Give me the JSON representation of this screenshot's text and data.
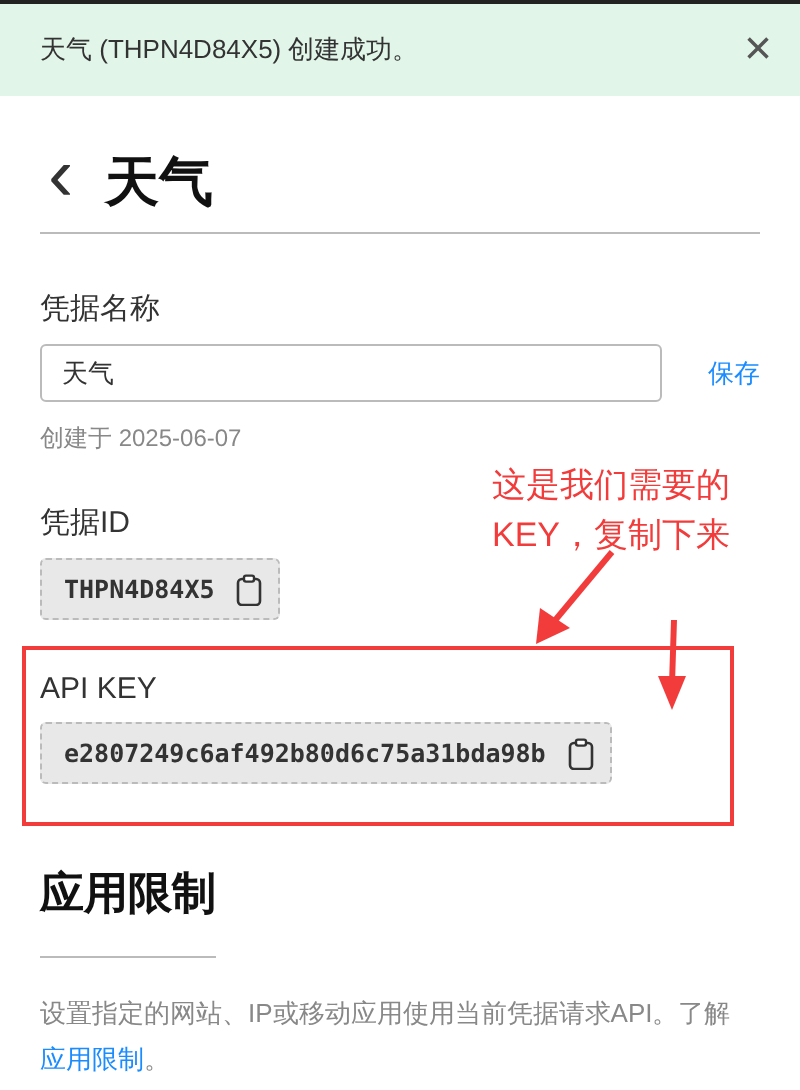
{
  "toast": {
    "message": "天气 (THPN4D84X5) 创建成功。",
    "close": "×"
  },
  "header": {
    "back": "‹",
    "title": "天气"
  },
  "name_field": {
    "label": "凭据名称",
    "value": "天气",
    "save": "保存",
    "created": "创建于 2025-06-07"
  },
  "credential_id": {
    "label": "凭据ID",
    "value": "THPN4D84X5"
  },
  "api_key": {
    "label": "API KEY",
    "value": "e2807249c6af492b80d6c75a31bda98b"
  },
  "restrictions": {
    "title": "应用限制",
    "text": "设置指定的网站、IP或移动应用使用当前凭据请求API。了解",
    "link": "应用限制",
    "after": "。"
  },
  "annotation": {
    "lines": [
      "这是我们需要的",
      "KEY，复制下来"
    ]
  }
}
